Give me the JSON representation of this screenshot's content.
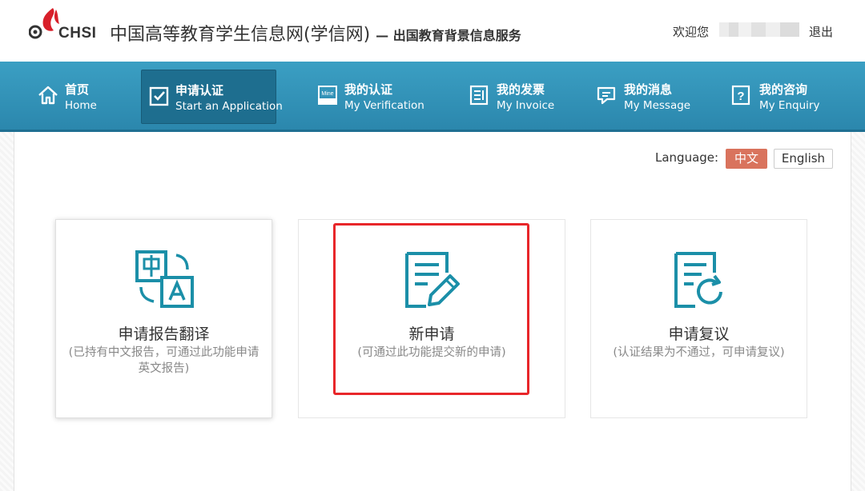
{
  "header": {
    "logo_text": "CHSI",
    "site_title": "中国高等教育学生信息网(学信网)",
    "site_subtitle": "— 出国教育背景信息服务",
    "welcome": "欢迎您",
    "logout": "退出"
  },
  "nav": [
    {
      "zh": "首页",
      "en": "Home",
      "icon": "home-icon"
    },
    {
      "zh": "申请认证",
      "en": "Start an Application",
      "icon": "checkbox-icon"
    },
    {
      "zh": "我的认证",
      "en": "My Verification",
      "icon": "mine-icon"
    },
    {
      "zh": "我的发票",
      "en": "My Invoice",
      "icon": "invoice-icon"
    },
    {
      "zh": "我的消息",
      "en": "My Message",
      "icon": "message-icon"
    },
    {
      "zh": "我的咨询",
      "en": "My Enquiry",
      "icon": "enquiry-icon"
    }
  ],
  "language": {
    "label": "Language:",
    "options": [
      "中文",
      "English"
    ],
    "selected": "中文"
  },
  "cards": [
    {
      "title": "申请报告翻译",
      "desc": "(已持有中文报告，可通过此功能申请英文报告)",
      "icon": "translate-icon"
    },
    {
      "title": "新申请",
      "desc": "(可通过此功能提交新的申请)",
      "icon": "edit-document-icon"
    },
    {
      "title": "申请复议",
      "desc": "(认证结果为不通过，可申请复议)",
      "icon": "review-document-icon"
    }
  ],
  "colors": {
    "nav_bg": "#3b9fc3",
    "nav_active": "#1e6e8f",
    "lang_selected": "#d9735d",
    "icon_teal": "#1b8fa8",
    "highlight": "#e8262a",
    "logo_red": "#d8202a"
  }
}
